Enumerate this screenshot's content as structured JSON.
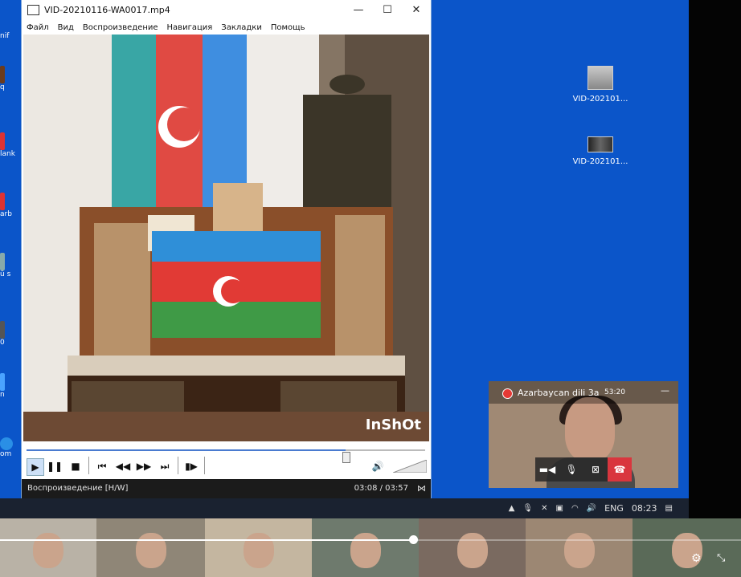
{
  "desktop": {
    "left_labels": [
      "nif",
      "q",
      "lank",
      "arb",
      "ü s",
      "0",
      "n",
      "om"
    ],
    "icons": [
      {
        "label": "VID-202101...",
        "icon": "video-file-icon"
      },
      {
        "label": "VID-202101...",
        "icon": "video-file-icon"
      }
    ]
  },
  "player": {
    "title": "VID-20210116-WA0017.mp4",
    "window_buttons": {
      "minimize": "—",
      "maximize": "☐",
      "close": "✕"
    },
    "menu": [
      "Файл",
      "Вид",
      "Воспроизведение",
      "Навигация",
      "Закладки",
      "Помощь"
    ],
    "video": {
      "watermark": "InShOt"
    },
    "seek_progress": 0.8,
    "volume_level": 0.0,
    "controls": [
      "play-icon",
      "pause-icon",
      "stop-icon",
      "skip-back-icon",
      "rewind-icon",
      "forward-icon",
      "skip-forward-icon",
      "frame-step-icon"
    ],
    "status": {
      "text": "Воспроизведение [H/W]",
      "time": "03:08 / 03:57"
    }
  },
  "call": {
    "name": "Azarbaycan dili 3a",
    "timer": "53:20"
  },
  "taskbar": {
    "lang": "ENG",
    "clock": "08:23"
  },
  "meeting": {
    "playback_progress": 0.557
  },
  "colors": {
    "desktop_blue": "#0b55c9",
    "end_call_red": "#d9363e",
    "record_red": "#e53935"
  }
}
